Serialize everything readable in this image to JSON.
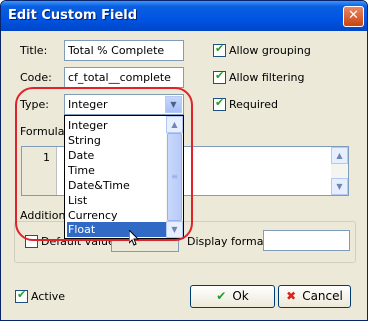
{
  "window": {
    "title": "Edit Custom Field",
    "close_glyph": "✕"
  },
  "fields": {
    "title_label": "Title:",
    "title_value": "Total % Complete",
    "code_label": "Code:",
    "code_value": "cf_total__complete",
    "type_label": "Type:",
    "type_value": "Integer",
    "formula_label": "Formula:",
    "additional_label": "Additional",
    "default_value_label": "Default value:",
    "display_format_label": "Display format:",
    "display_format_value": ""
  },
  "options": {
    "allow_grouping": {
      "label": "Allow grouping",
      "checked": true
    },
    "allow_filtering": {
      "label": "Allow filtering",
      "checked": true
    },
    "required": {
      "label": "Required",
      "checked": true
    },
    "default_value": {
      "checked": false
    },
    "active": {
      "label": "Active",
      "checked": true
    }
  },
  "editor": {
    "line_number": "1"
  },
  "type_dropdown": {
    "items": [
      "Integer",
      "String",
      "Date",
      "Time",
      "Date&Time",
      "List",
      "Currency",
      "Float"
    ],
    "selected": "Float"
  },
  "buttons": {
    "ok": "Ok",
    "cancel": "Cancel"
  },
  "icons": {
    "check": "check-icon",
    "ok": "green-check-icon",
    "cancel": "red-x-icon",
    "close": "close-icon",
    "cursor": "mouse-pointer-icon"
  },
  "colors": {
    "highlight": "#e0232a",
    "selection": "#316ac5",
    "titlebar": "#0054e3"
  }
}
